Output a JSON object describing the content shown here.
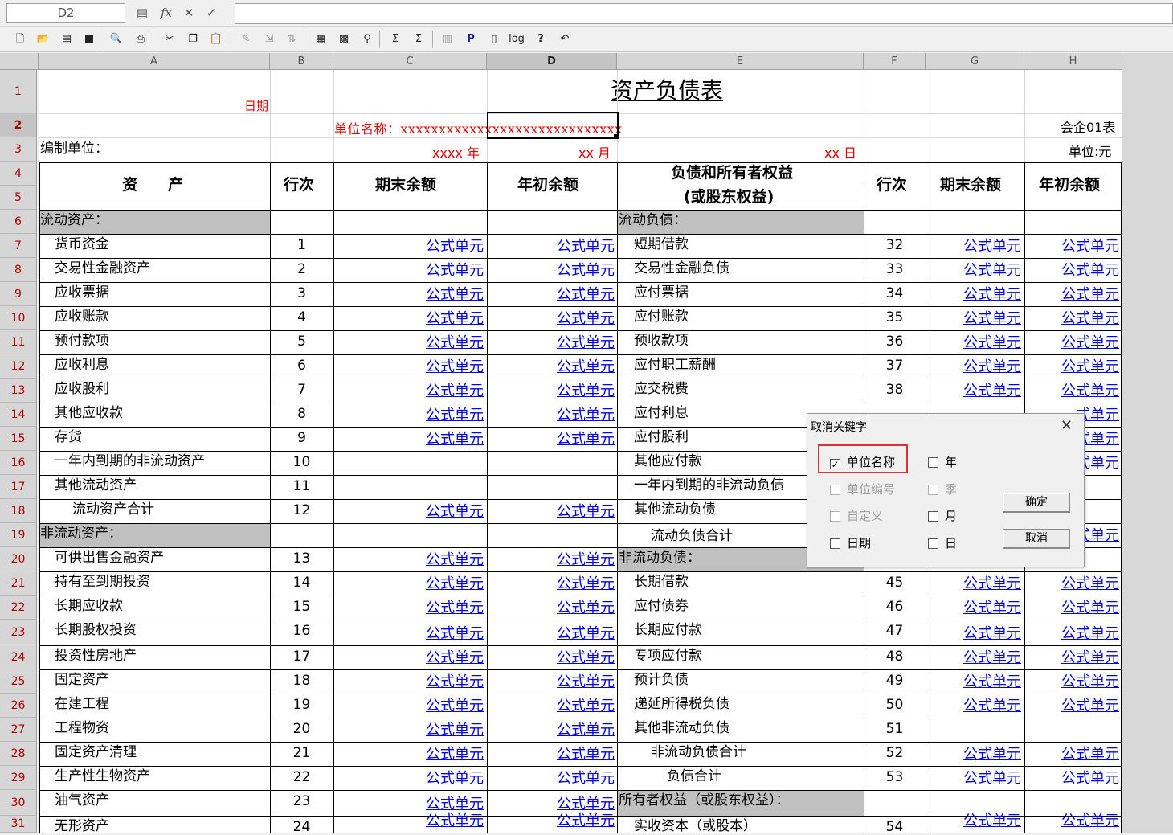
{
  "formula_bar": {
    "cell_ref": "D2",
    "fx": "fx",
    "cancel": "✕",
    "confirm": "✓",
    "value": ""
  },
  "toolbar": {
    "icons": [
      "new-file-icon",
      "open-folder-icon",
      "document-icon",
      "save-icon",
      "print-preview-icon",
      "print-icon",
      "cut-icon",
      "copy-icon",
      "paste-icon",
      "format-brush-icon",
      "insert-icon",
      "sort-icon",
      "table-icon",
      "grid-icon",
      "find-icon",
      "sum-icon",
      "sum-select-icon",
      "chart-icon",
      "p-icon",
      "page-icon",
      "log-icon",
      "help-icon",
      "undo-icon"
    ],
    "labels": {
      "p": "P",
      "log": "log",
      "help": "?"
    }
  },
  "columns": [
    "A",
    "B",
    "C",
    "D",
    "E",
    "F",
    "G",
    "H"
  ],
  "rows": [
    "1",
    "2",
    "3",
    "4",
    "5",
    "6",
    "7",
    "8",
    "9",
    "10",
    "11",
    "12",
    "13",
    "14",
    "15",
    "16",
    "17",
    "18",
    "19",
    "20",
    "21",
    "22",
    "23",
    "24",
    "25",
    "26",
    "27",
    "28",
    "29",
    "30",
    "31"
  ],
  "sheet": {
    "title": "资产负债表",
    "date_label": "日期",
    "unit_name": "单位名称：xxxxxxxxxxxxxxxxxxxxxxxxxxxxx",
    "form_code": "会企01表",
    "compiler": "编制单位：",
    "year": "xxxx 年",
    "month": "xx 月",
    "day": "xx 日",
    "currency": "单位:元",
    "headers": {
      "assets": "资　　产",
      "line": "行次",
      "end_balance": "期末余额",
      "begin_balance": "年初余额",
      "liabilities_1": "负债和所有者权益",
      "liabilities_2": "(或股东权益)",
      "line2": "行次",
      "end_balance2": "期末余额",
      "begin_balance2": "年初余额"
    },
    "formula_text": "公式单元",
    "rows": [
      {
        "a": "流动资产：",
        "b": "",
        "c": "",
        "d": "",
        "e": "流动负债：",
        "f": "",
        "g": "",
        "h": ""
      },
      {
        "a": "货币资金",
        "b": "1",
        "c": "公式单元",
        "d": "公式单元",
        "e": "短期借款",
        "f": "32",
        "g": "公式单元",
        "h": "公式单元"
      },
      {
        "a": "交易性金融资产",
        "b": "2",
        "c": "公式单元",
        "d": "公式单元",
        "e": "交易性金融负债",
        "f": "33",
        "g": "公式单元",
        "h": "公式单元"
      },
      {
        "a": "应收票据",
        "b": "3",
        "c": "公式单元",
        "d": "公式单元",
        "e": "应付票据",
        "f": "34",
        "g": "公式单元",
        "h": "公式单元"
      },
      {
        "a": "应收账款",
        "b": "4",
        "c": "公式单元",
        "d": "公式单元",
        "e": "应付账款",
        "f": "35",
        "g": "公式单元",
        "h": "公式单元"
      },
      {
        "a": "预付款项",
        "b": "5",
        "c": "公式单元",
        "d": "公式单元",
        "e": "预收款项",
        "f": "36",
        "g": "公式单元",
        "h": "公式单元"
      },
      {
        "a": "应收利息",
        "b": "6",
        "c": "公式单元",
        "d": "公式单元",
        "e": "应付职工薪酬",
        "f": "37",
        "g": "公式单元",
        "h": "公式单元"
      },
      {
        "a": "应收股利",
        "b": "7",
        "c": "公式单元",
        "d": "公式单元",
        "e": "应交税费",
        "f": "38",
        "g": "公式单元",
        "h": "公式单元"
      },
      {
        "a": "其他应收款",
        "b": "8",
        "c": "公式单元",
        "d": "公式单元",
        "e": "应付利息",
        "f": "",
        "g": "",
        "h": "式单元"
      },
      {
        "a": "存货",
        "b": "9",
        "c": "公式单元",
        "d": "公式单元",
        "e": "应付股利",
        "f": "",
        "g": "",
        "h": "式单元"
      },
      {
        "a": "一年内到期的非流动资产",
        "b": "10",
        "c": "",
        "d": "",
        "e": "其他应付款",
        "f": "",
        "g": "",
        "h": "式单元"
      },
      {
        "a": "其他流动资产",
        "b": "11",
        "c": "",
        "d": "",
        "e": "一年内到期的非流动负债",
        "f": "",
        "g": "",
        "h": ""
      },
      {
        "a": "流动资产合计",
        "b": "12",
        "c": "公式单元",
        "d": "公式单元",
        "e": "其他流动负债",
        "f": "",
        "g": "",
        "h": ""
      },
      {
        "a": "非流动资产：",
        "b": "",
        "c": "",
        "d": "",
        "e": "流动负债合计",
        "f": "",
        "g": "",
        "h": "式单元"
      },
      {
        "a": "可供出售金融资产",
        "b": "13",
        "c": "公式单元",
        "d": "公式单元",
        "e": "非流动负债：",
        "f": "",
        "g": "",
        "h": ""
      },
      {
        "a": "持有至到期投资",
        "b": "14",
        "c": "公式单元",
        "d": "公式单元",
        "e": "长期借款",
        "f": "45",
        "g": "公式单元",
        "h": "公式单元"
      },
      {
        "a": "长期应收款",
        "b": "15",
        "c": "公式单元",
        "d": "公式单元",
        "e": "应付债券",
        "f": "46",
        "g": "公式单元",
        "h": "公式单元"
      },
      {
        "a": "长期股权投资",
        "b": "16",
        "c": "公式单元",
        "d": "公式单元",
        "e": "长期应付款",
        "f": "47",
        "g": "公式单元",
        "h": "公式单元"
      },
      {
        "a": "投资性房地产",
        "b": "17",
        "c": "公式单元",
        "d": "公式单元",
        "e": "专项应付款",
        "f": "48",
        "g": "公式单元",
        "h": "公式单元"
      },
      {
        "a": "固定资产",
        "b": "18",
        "c": "公式单元",
        "d": "公式单元",
        "e": "预计负债",
        "f": "49",
        "g": "公式单元",
        "h": "公式单元"
      },
      {
        "a": "在建工程",
        "b": "19",
        "c": "公式单元",
        "d": "公式单元",
        "e": "递延所得税负债",
        "f": "50",
        "g": "公式单元",
        "h": "公式单元"
      },
      {
        "a": "工程物资",
        "b": "20",
        "c": "公式单元",
        "d": "公式单元",
        "e": "其他非流动负债",
        "f": "51",
        "g": "",
        "h": ""
      },
      {
        "a": "固定资产清理",
        "b": "21",
        "c": "公式单元",
        "d": "公式单元",
        "e": "非流动负债合计",
        "f": "52",
        "g": "公式单元",
        "h": "公式单元"
      },
      {
        "a": "生产性生物资产",
        "b": "22",
        "c": "公式单元",
        "d": "公式单元",
        "e": "负债合计",
        "f": "53",
        "g": "公式单元",
        "h": "公式单元"
      },
      {
        "a": "油气资产",
        "b": "23",
        "c": "公式单元",
        "d": "公式单元",
        "e": "所有者权益（或股东权益）：",
        "f": "",
        "g": "",
        "h": ""
      },
      {
        "a": "无形资产",
        "b": "24",
        "c": "公式单元",
        "d": "公式单元",
        "e": "实收资本（或股本）",
        "f": "54",
        "g": "公式单元",
        "h": "公式单元"
      }
    ]
  },
  "dialog": {
    "title": "取消关键字",
    "close": "✕",
    "checkboxes": [
      {
        "label": "单位名称",
        "checked": true,
        "enabled": true
      },
      {
        "label": "单位编号",
        "checked": false,
        "enabled": false
      },
      {
        "label": "自定义",
        "checked": false,
        "enabled": false
      },
      {
        "label": "日期",
        "checked": false,
        "enabled": true
      },
      {
        "label": "年",
        "checked": false,
        "enabled": true
      },
      {
        "label": "季",
        "checked": false,
        "enabled": false
      },
      {
        "label": "月",
        "checked": false,
        "enabled": true
      },
      {
        "label": "日",
        "checked": false,
        "enabled": true
      }
    ],
    "ok": "确定",
    "cancel": "取消",
    "check_mark": "✓"
  }
}
